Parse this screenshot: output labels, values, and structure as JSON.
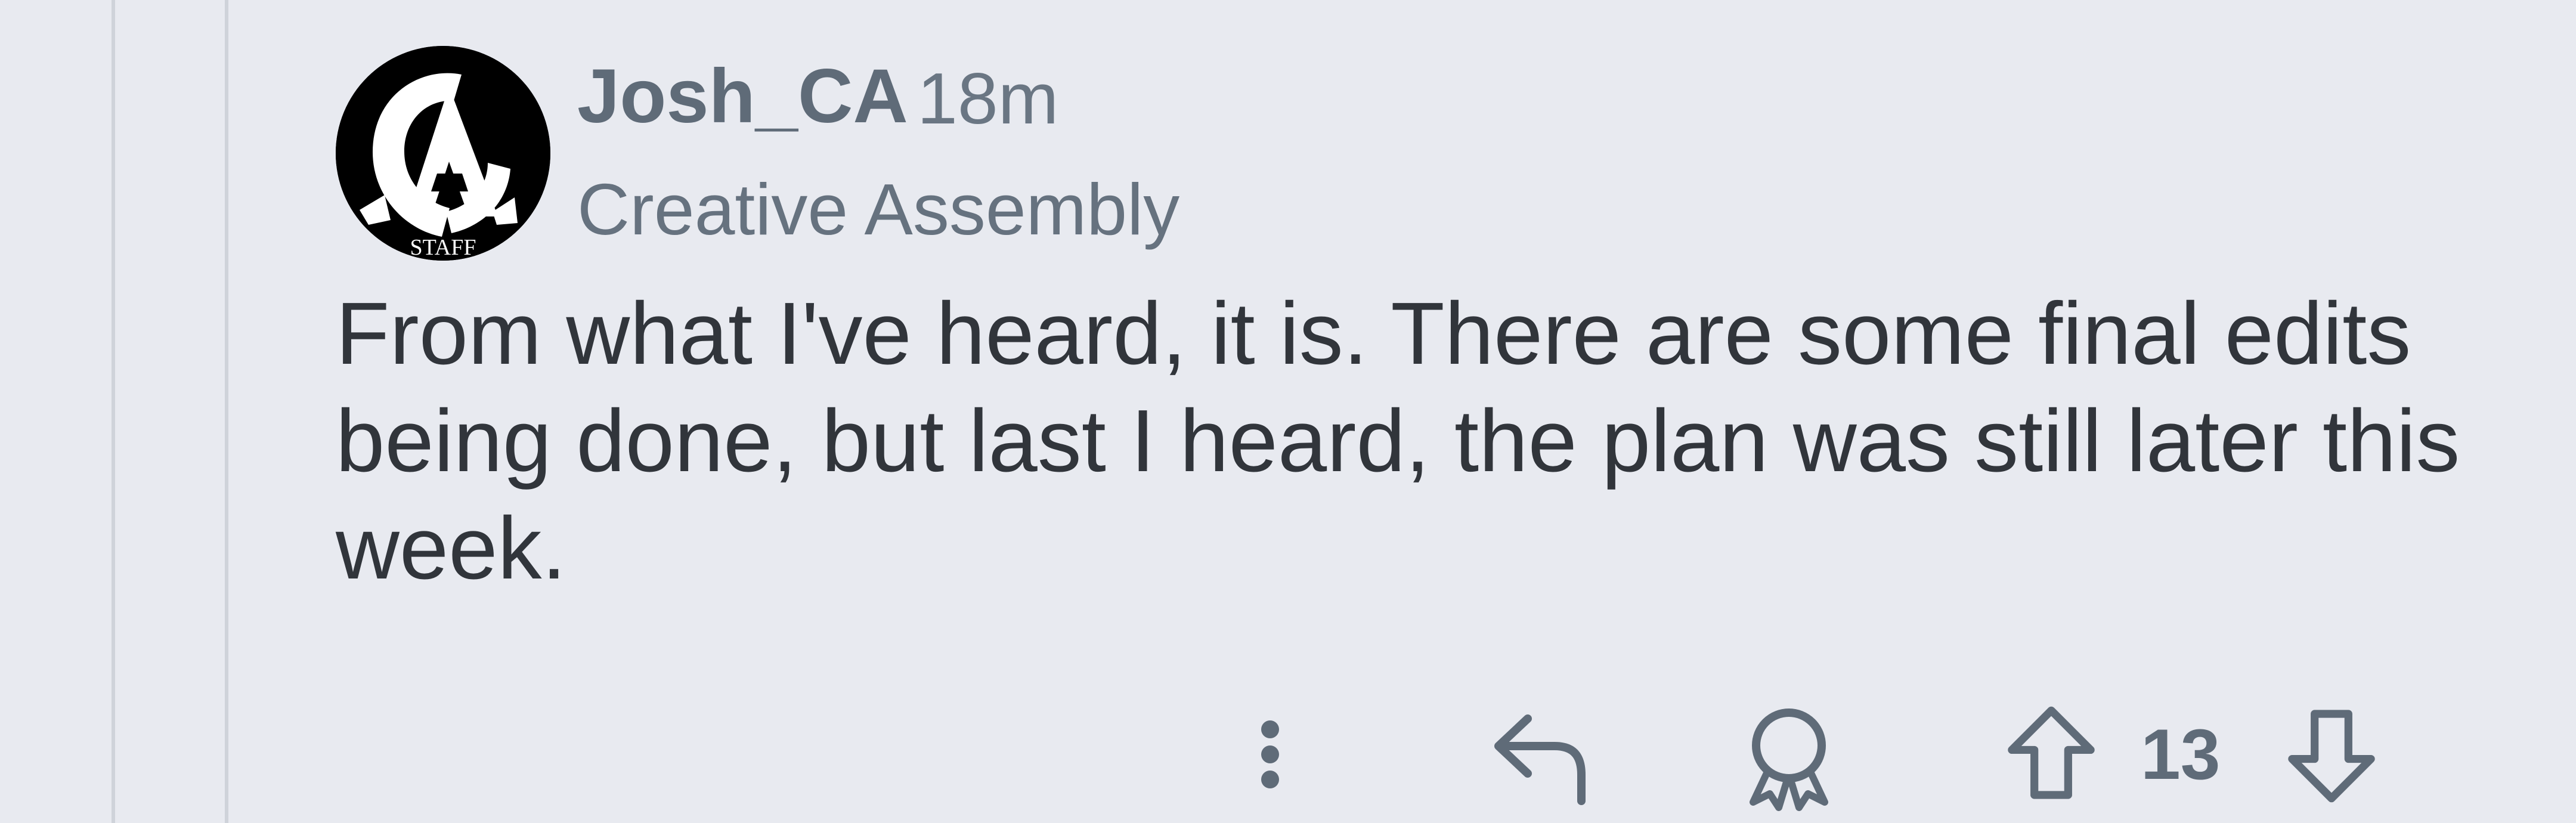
{
  "comment": {
    "username": "Josh_CA",
    "timestamp": "18m",
    "flair": "Creative Assembly",
    "avatar_badge": "STAFF",
    "body": "From what I've heard, it is. There are some final edits being done, but last I heard, the plan was still later this week.",
    "score": "13"
  },
  "actions": {
    "more_icon": "more-vertical-icon",
    "reply_icon": "reply-arrow-icon",
    "award_icon": "award-ribbon-icon",
    "upvote_icon": "up-arrow-icon",
    "downvote_icon": "down-arrow-icon"
  },
  "colors": {
    "background": "#e8eaf0",
    "text_primary": "#31353b",
    "text_secondary": "#5f6b78",
    "icon": "#5f6b78"
  }
}
